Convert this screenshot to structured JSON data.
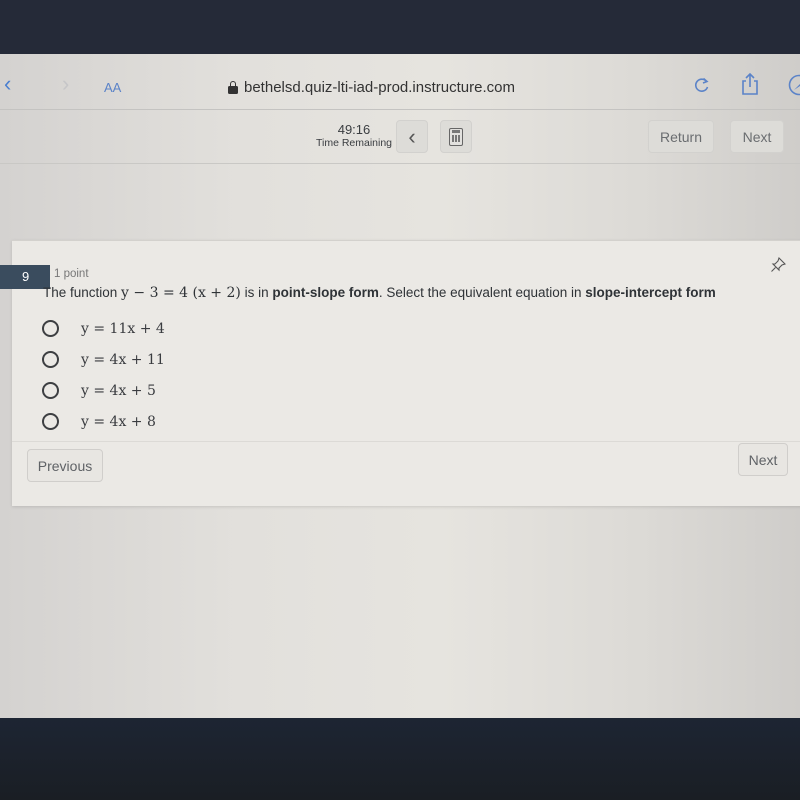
{
  "browser": {
    "reader_label": "AA",
    "url": "bethelsd.quiz-lti-iad-prod.instructure.com",
    "icons": {
      "back": "chevron-left-icon",
      "forward": "chevron-right-icon",
      "lock": "lock-icon",
      "reload": "reload-icon",
      "share": "share-icon",
      "extension": "compass-icon"
    }
  },
  "quiz_header": {
    "timer_value": "49:16",
    "timer_label": "Time Remaining",
    "collapse_glyph": "‹",
    "return_label": "Return",
    "next_label": "Next"
  },
  "question": {
    "number": "9",
    "points": "1 point",
    "text_prefix": "The function ",
    "equation": "y − 3 = 4 (x + 2)",
    "text_mid": " is in ",
    "bold1": "point-slope form",
    "text_mid2": ". Select the equivalent equation in ",
    "bold2": "slope-intercept form",
    "answers": [
      {
        "label": "y = 11x + 4",
        "selected": false
      },
      {
        "label": "y = 4x + 11",
        "selected": false
      },
      {
        "label": "y = 4x + 5",
        "selected": false
      },
      {
        "label": "y = 4x + 8",
        "selected": false
      }
    ]
  },
  "footer": {
    "previous_label": "Previous",
    "next_label": "Next"
  },
  "colors": {
    "link_blue": "#4a7fd0",
    "question_badge": "#3a4c5e"
  }
}
